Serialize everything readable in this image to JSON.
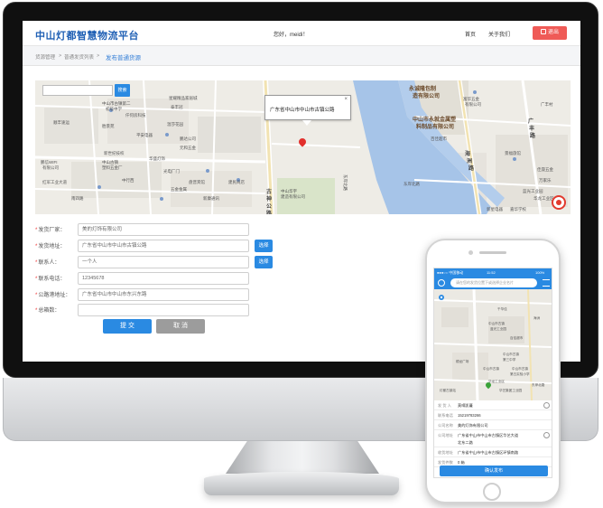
{
  "header": {
    "logo": "中山灯都智慧物流平台",
    "greeting": "您好，meidi！",
    "nav_home": "首页",
    "nav_about": "关于我们",
    "logout": "退出"
  },
  "breadcrumb": {
    "items": [
      "货源管理",
      "普通发货列表"
    ],
    "current": "发布普通货源"
  },
  "map": {
    "search_placeholder": "",
    "search_button": "搜索",
    "popup_address": "广东省中山市中山市古镇公路",
    "popup_close": "×",
    "labels": {
      "company1": "永诚隆包制",
      "company1b": "造有限公司",
      "company2": "中山市永就金属塑",
      "company2b": "料制品有限公司",
      "road1": "古",
      "road2": "神",
      "road3": "公",
      "road4": "路",
      "road5": "海",
      "road6": "洲",
      "road7": "路",
      "road8": "广",
      "road9": "丰",
      "road10": "路",
      "l1": "中山市古镇第二",
      "l2": "初级中学",
      "l3": "星耀精品家居城",
      "l4": "泰丰冠",
      "l5": "温莎花园",
      "l6": "仟何房科技",
      "l7": "顺丰速运",
      "l8": "胜景苑",
      "l9": "鹏达公司",
      "l10": "平安电器",
      "l11": "元和五金",
      "l12": "新世纪技校",
      "l13": "中山古镇",
      "l14": "塑料五金厂",
      "l15": "鹏信WIFI",
      "l16": "有限公司",
      "l17": "红军工业大道",
      "l18": "光电厂门",
      "l19": "中行西",
      "l20": "华盛灯饰",
      "l21": "盘晋宾馆",
      "l22": "五金金属",
      "l23": "南四路",
      "l24": "新康通讯",
      "l25": "建民商店",
      "l26": "中山华宇",
      "l27": "建造有限公司",
      "l28": "蓝光工业园",
      "l29": "广丰村",
      "l30": "华龙工业区",
      "l31": "东岸北路",
      "l32": "东岸北路",
      "l33": "景福旅馆",
      "l34": "佳晟五金",
      "l35": "万家乐",
      "l36": "富华五金",
      "l37": "有限公司",
      "l38": "嘉华学校",
      "l39": "百佳超市",
      "l40": "新星电器"
    }
  },
  "form": {
    "rows": [
      {
        "label": "发货厂家：",
        "required": true,
        "value": "美的灯饰有限公司",
        "has_pick": false
      },
      {
        "label": "发货地址：",
        "required": true,
        "value": "广东省中山市中山市古镇公路",
        "has_pick": true
      },
      {
        "label": "联系人：",
        "required": true,
        "value": "一个人",
        "has_pick": true
      },
      {
        "label": "联系电话：",
        "required": true,
        "value": "12345678",
        "has_pick": false
      },
      {
        "label": "公路港地址：",
        "required": true,
        "value": "广东省中山市中山市东兴东路",
        "has_pick": false
      },
      {
        "label": "总箱数：",
        "required": true,
        "value": "",
        "has_pick": false
      }
    ],
    "pick_label": "选择",
    "submit": "提 交",
    "cancel": "取 消"
  },
  "phone": {
    "status_carrier": "●●●○○ 中国移动",
    "status_time": "11:52",
    "status_battery": "100%",
    "search_placeholder": "请在您的发货位置下或选择企业名片",
    "map_labels": {
      "p1": "千华佳",
      "p2": "中山市古镇",
      "p3": "蓝光工业园",
      "p4": "百佳超市",
      "p5": "中山市古镇",
      "p6": "第三中学",
      "p7": "中山市古镇",
      "p8": "顺龙广场",
      "p9": "华龙工业区",
      "p10": "灯都古镇站",
      "p11": "华艺集团工业园",
      "p12": "中山市古镇",
      "p13": "第五实验小学",
      "p14": "海洲",
      "p15": "东岸北路"
    },
    "rows": [
      {
        "k": "发 货 人",
        "v": "莫嘀凯蔓"
      },
      {
        "k": "联系电话",
        "v": "15219783266"
      },
      {
        "k": "公司名称",
        "v": "美的灯饰有限公司"
      },
      {
        "k": "公司地址",
        "v": "广东省中山市中山市古镇区华艺大道"
      },
      {
        "k": "",
        "v": "北东二路"
      },
      {
        "k": "收货地址",
        "v": "广东省中山市中山市古镇区环镇南路"
      },
      {
        "k": "发货件数",
        "v": "0    箱"
      }
    ],
    "confirm": "确认发布"
  }
}
